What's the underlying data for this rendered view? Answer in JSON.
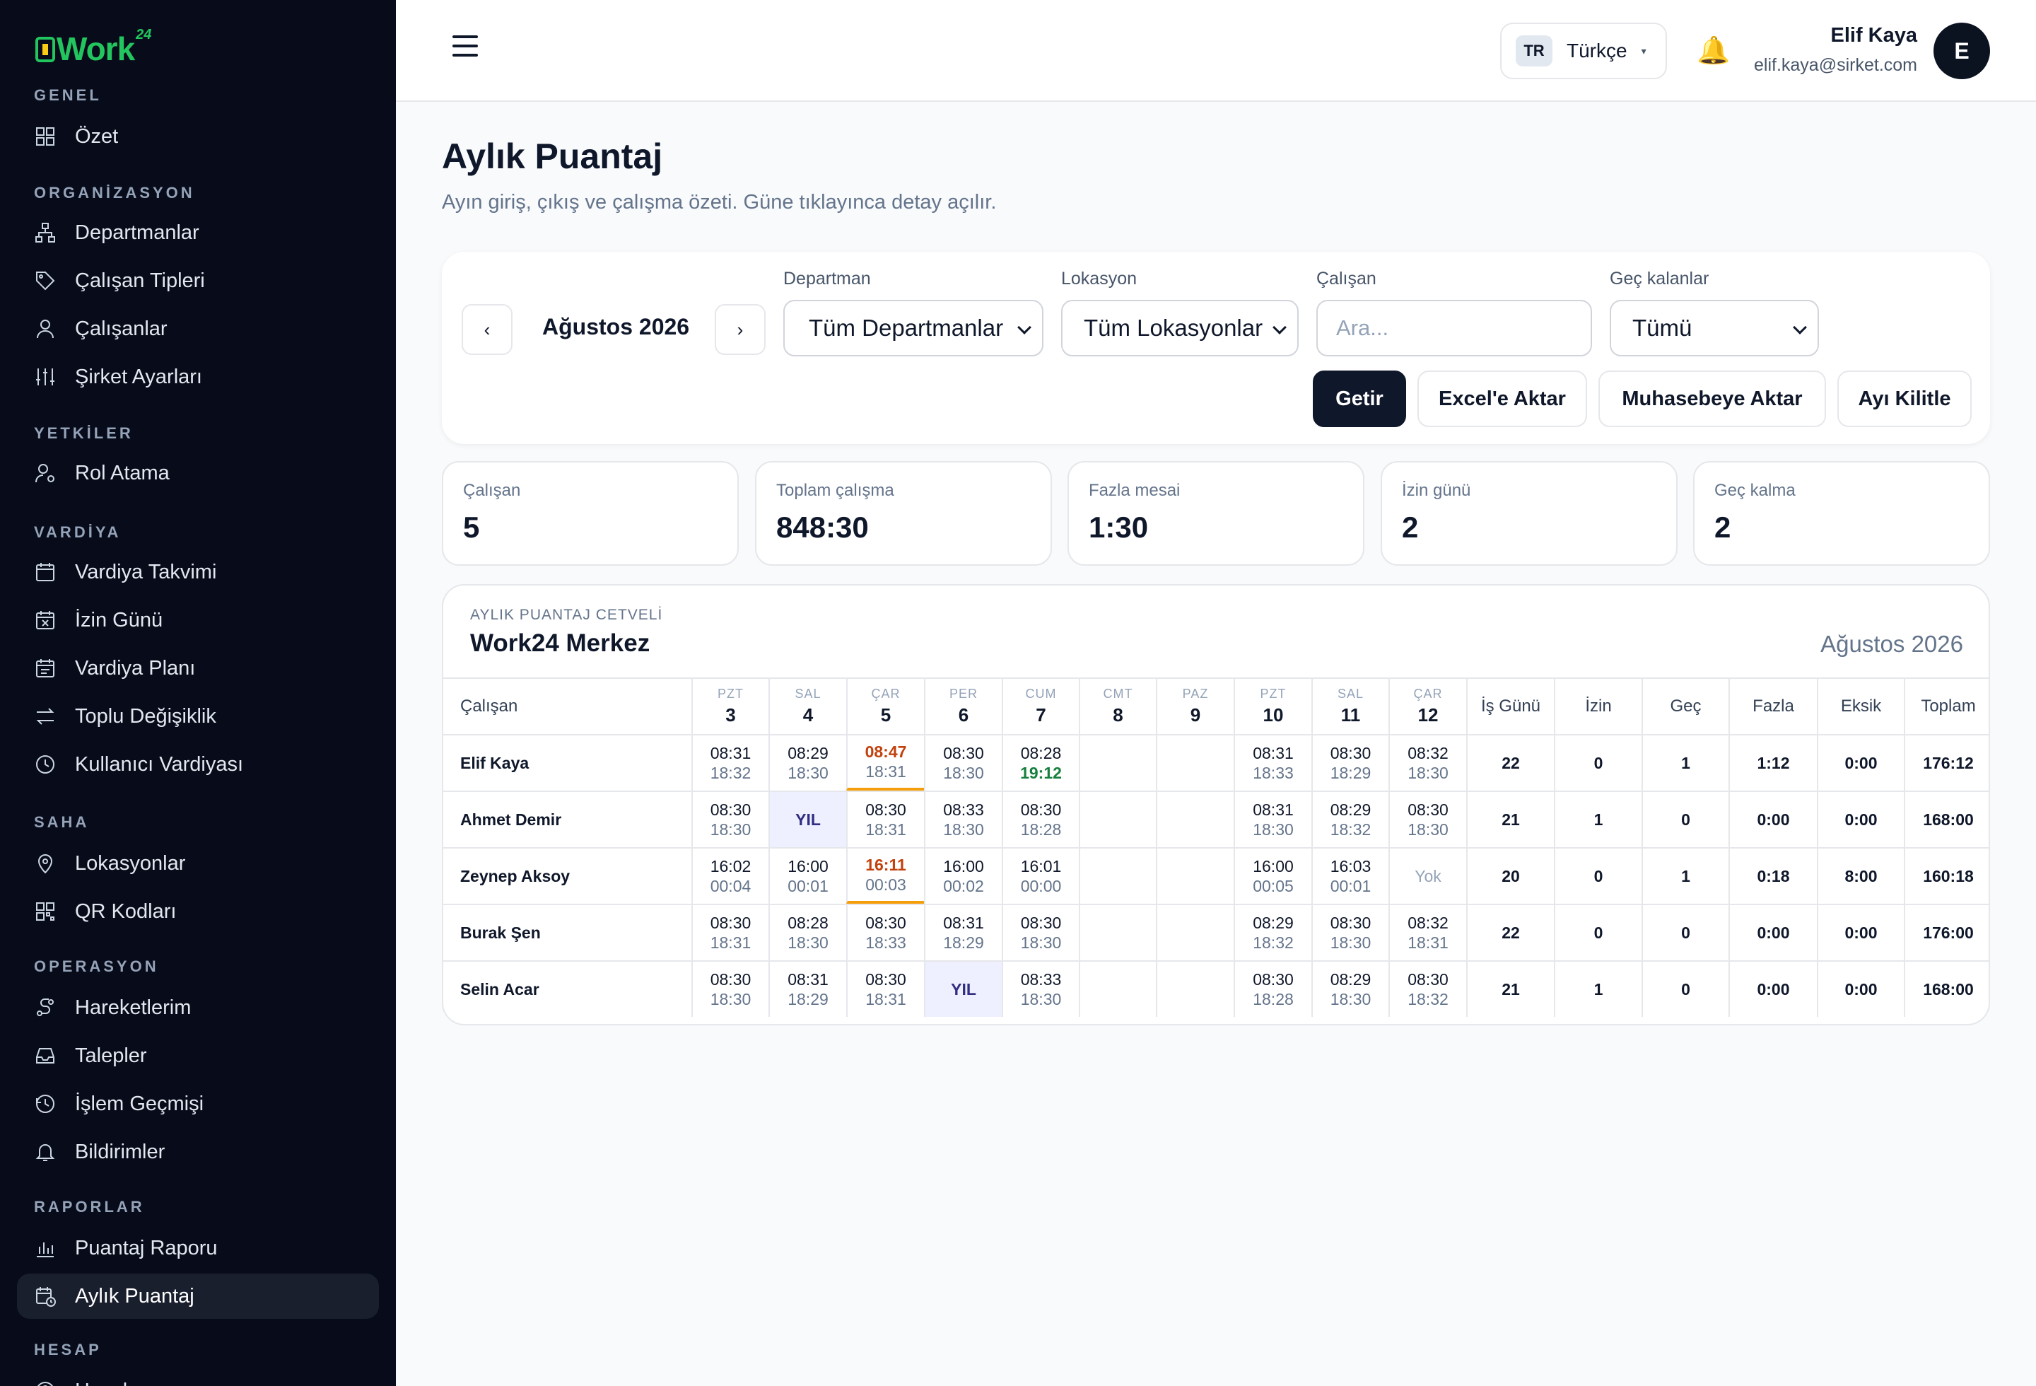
{
  "brand": {
    "name": "Work",
    "sup": "24"
  },
  "sidebar": {
    "sections": [
      {
        "title": "GENEL",
        "items": [
          {
            "label": "Özet",
            "icon": "grid-icon"
          }
        ]
      },
      {
        "title": "ORGANİZASYON",
        "items": [
          {
            "label": "Departmanlar",
            "icon": "org-icon"
          },
          {
            "label": "Çalışan Tipleri",
            "icon": "tag-icon"
          },
          {
            "label": "Çalışanlar",
            "icon": "user-icon"
          },
          {
            "label": "Şirket Ayarları",
            "icon": "sliders-icon"
          }
        ]
      },
      {
        "title": "YETKİLER",
        "items": [
          {
            "label": "Rol Atama",
            "icon": "user-cog-icon"
          }
        ]
      },
      {
        "title": "VARDİYA",
        "items": [
          {
            "label": "Vardiya Takvimi",
            "icon": "calendar-icon"
          },
          {
            "label": "İzin Günü",
            "icon": "calendar-x-icon"
          },
          {
            "label": "Vardiya Planı",
            "icon": "calendar-list-icon"
          },
          {
            "label": "Toplu Değişiklik",
            "icon": "swap-icon"
          },
          {
            "label": "Kullanıcı Vardiyası",
            "icon": "clock-icon"
          }
        ]
      },
      {
        "title": "SAHA",
        "items": [
          {
            "label": "Lokasyonlar",
            "icon": "pin-icon"
          },
          {
            "label": "QR Kodları",
            "icon": "qr-icon"
          }
        ]
      },
      {
        "title": "OPERASYON",
        "items": [
          {
            "label": "Hareketlerim",
            "icon": "route-icon"
          },
          {
            "label": "Talepler",
            "icon": "inbox-icon"
          },
          {
            "label": "İşlem Geçmişi",
            "icon": "history-icon"
          },
          {
            "label": "Bildirimler",
            "icon": "bell-icon"
          }
        ]
      },
      {
        "title": "RAPORLAR",
        "items": [
          {
            "label": "Puantaj Raporu",
            "icon": "bar-chart-icon"
          },
          {
            "label": "Aylık Puantaj",
            "icon": "calendar-clock-icon",
            "active": true
          }
        ]
      },
      {
        "title": "HESAP",
        "items": [
          {
            "label": "Hesabım",
            "icon": "account-icon"
          }
        ]
      }
    ]
  },
  "topbar": {
    "lang_code": "TR",
    "lang_label": "Türkçe",
    "user_name": "Elif Kaya",
    "user_email": "elif.kaya@sirket.com",
    "avatar_letter": "E"
  },
  "page": {
    "title": "Aylık Puantaj",
    "subtitle": "Ayın giriş, çıkış ve çalışma özeti. Güne tıklayınca detay açılır."
  },
  "filters": {
    "prev": "‹",
    "next": "›",
    "month": "Ağustos 2026",
    "department_label": "Departman",
    "department_value": "Tüm Departmanlar",
    "location_label": "Lokasyon",
    "location_value": "Tüm Lokasyonlar",
    "employee_label": "Çalışan",
    "employee_placeholder": "Ara...",
    "late_label": "Geç kalanlar",
    "late_value": "Tümü",
    "btn_fetch": "Getir",
    "btn_excel": "Excel'e Aktar",
    "btn_accounting": "Muhasebeye Aktar",
    "btn_lock": "Ayı Kilitle"
  },
  "stats": [
    {
      "label": "Çalışan",
      "value": "5"
    },
    {
      "label": "Toplam çalışma",
      "value": "848:30"
    },
    {
      "label": "Fazla mesai",
      "value": "1:30"
    },
    {
      "label": "İzin günü",
      "value": "2"
    },
    {
      "label": "Geç kalma",
      "value": "2"
    }
  ],
  "table": {
    "kicker": "AYLIK PUANTAJ CETVELİ",
    "title": "Work24 Merkez",
    "month": "Ağustos 2026",
    "employee_header": "Çalışan",
    "days": [
      {
        "dow": "PZT",
        "day": "3"
      },
      {
        "dow": "SAL",
        "day": "4"
      },
      {
        "dow": "ÇAR",
        "day": "5"
      },
      {
        "dow": "PER",
        "day": "6"
      },
      {
        "dow": "CUM",
        "day": "7"
      },
      {
        "dow": "CMT",
        "day": "8"
      },
      {
        "dow": "PAZ",
        "day": "9"
      },
      {
        "dow": "PZT",
        "day": "10"
      },
      {
        "dow": "SAL",
        "day": "11"
      },
      {
        "dow": "ÇAR",
        "day": "12"
      }
    ],
    "summary_headers": [
      "İş Günü",
      "İzin",
      "Geç",
      "Fazla",
      "Eksik",
      "Toplam"
    ],
    "rows": [
      {
        "name": "Elif Kaya",
        "cells": [
          {
            "in": "08:31",
            "out": "18:32"
          },
          {
            "in": "08:29",
            "out": "18:30"
          },
          {
            "in": "08:47",
            "out": "18:31",
            "late": true
          },
          {
            "in": "08:30",
            "out": "18:30"
          },
          {
            "in": "08:28",
            "out": "19:12",
            "over": true
          },
          {},
          {},
          {
            "in": "08:31",
            "out": "18:33"
          },
          {
            "in": "08:30",
            "out": "18:29"
          },
          {
            "in": "08:32",
            "out": "18:30"
          }
        ],
        "summary": [
          "22",
          "0",
          "1",
          "1:12",
          "0:00",
          "176:12"
        ]
      },
      {
        "name": "Ahmet Demir",
        "cells": [
          {
            "in": "08:30",
            "out": "18:30"
          },
          {
            "leave": "YIL"
          },
          {
            "in": "08:30",
            "out": "18:31"
          },
          {
            "in": "08:33",
            "out": "18:30"
          },
          {
            "in": "08:30",
            "out": "18:28"
          },
          {},
          {},
          {
            "in": "08:31",
            "out": "18:30"
          },
          {
            "in": "08:29",
            "out": "18:32"
          },
          {
            "in": "08:30",
            "out": "18:30"
          }
        ],
        "summary": [
          "21",
          "1",
          "0",
          "0:00",
          "0:00",
          "168:00"
        ]
      },
      {
        "name": "Zeynep Aksoy",
        "cells": [
          {
            "in": "16:02",
            "out": "00:04"
          },
          {
            "in": "16:00",
            "out": "00:01"
          },
          {
            "in": "16:11",
            "out": "00:03",
            "late": true
          },
          {
            "in": "16:00",
            "out": "00:02"
          },
          {
            "in": "16:01",
            "out": "00:00"
          },
          {},
          {},
          {
            "in": "16:00",
            "out": "00:05"
          },
          {
            "in": "16:03",
            "out": "00:01"
          },
          {
            "none": "Yok"
          }
        ],
        "summary": [
          "20",
          "0",
          "1",
          "0:18",
          "8:00",
          "160:18"
        ]
      },
      {
        "name": "Burak Şen",
        "cells": [
          {
            "in": "08:30",
            "out": "18:31"
          },
          {
            "in": "08:28",
            "out": "18:30"
          },
          {
            "in": "08:30",
            "out": "18:33"
          },
          {
            "in": "08:31",
            "out": "18:29"
          },
          {
            "in": "08:30",
            "out": "18:30"
          },
          {},
          {},
          {
            "in": "08:29",
            "out": "18:32"
          },
          {
            "in": "08:30",
            "out": "18:30"
          },
          {
            "in": "08:32",
            "out": "18:31"
          }
        ],
        "summary": [
          "22",
          "0",
          "0",
          "0:00",
          "0:00",
          "176:00"
        ]
      },
      {
        "name": "Selin Acar",
        "cells": [
          {
            "in": "08:30",
            "out": "18:30"
          },
          {
            "in": "08:31",
            "out": "18:29"
          },
          {
            "in": "08:30",
            "out": "18:31"
          },
          {
            "leave": "YIL"
          },
          {
            "in": "08:33",
            "out": "18:30"
          },
          {},
          {},
          {
            "in": "08:30",
            "out": "18:28"
          },
          {
            "in": "08:29",
            "out": "18:30"
          },
          {
            "in": "08:30",
            "out": "18:32"
          }
        ],
        "summary": [
          "21",
          "1",
          "0",
          "0:00",
          "0:00",
          "168:00"
        ]
      }
    ]
  }
}
